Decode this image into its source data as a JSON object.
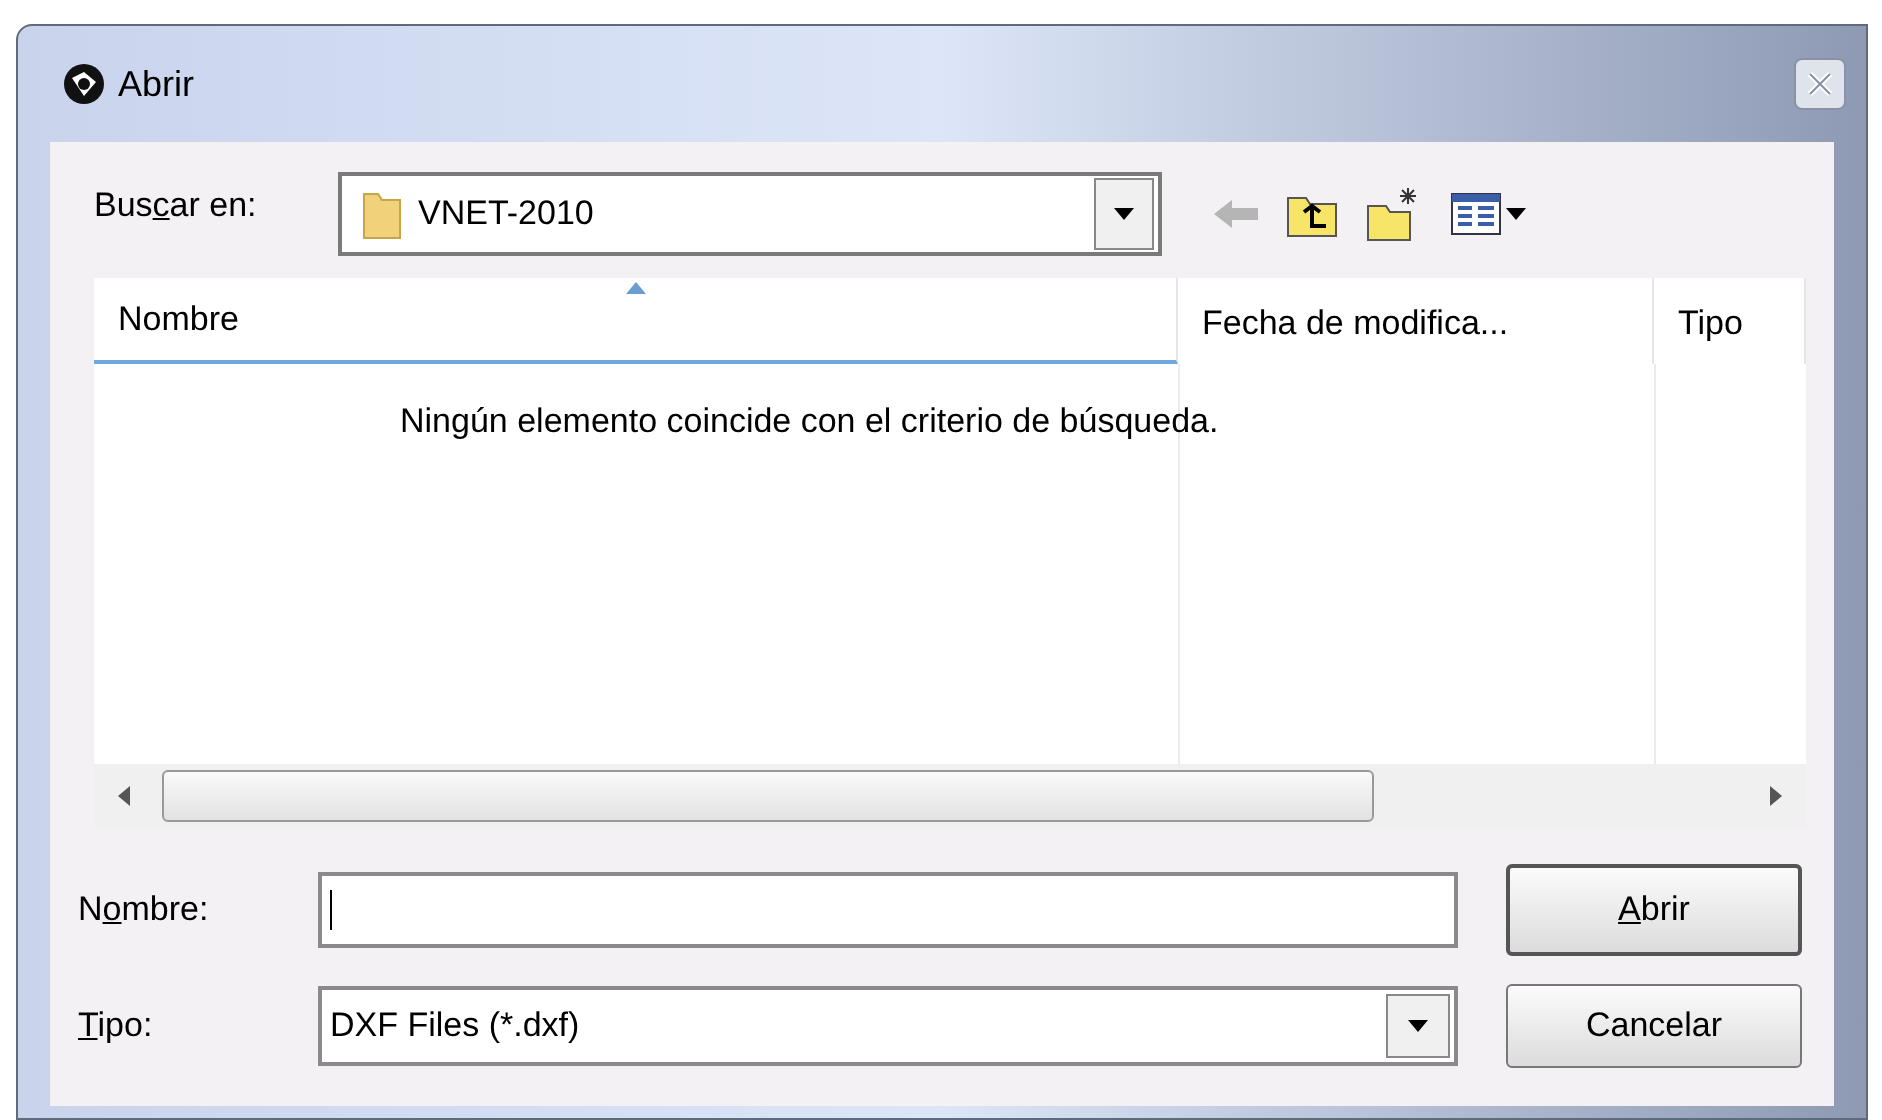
{
  "window": {
    "title": "Abrir"
  },
  "look_in": {
    "label_parts": [
      {
        "text": "Bus",
        "underlined": false
      },
      {
        "text": "c",
        "underlined": true
      },
      {
        "text": "ar en:",
        "underlined": false
      }
    ],
    "value": "VNET-2010"
  },
  "file_list": {
    "columns": [
      {
        "label": "Nombre",
        "sorted": true
      },
      {
        "label": "Fecha de modifica...",
        "sorted": false
      },
      {
        "label": "Tipo",
        "sorted": false
      }
    ],
    "empty_message": "Ningún elemento coincide con el criterio de búsqueda."
  },
  "file_name": {
    "label_parts": [
      {
        "text": "N",
        "underlined": false
      },
      {
        "text": "o",
        "underlined": true
      },
      {
        "text": "mbre:",
        "underlined": false
      }
    ],
    "focused": true
  },
  "file_type": {
    "label_parts": [
      {
        "text": "T",
        "underlined": true
      },
      {
        "text": "ipo:",
        "underlined": false
      }
    ],
    "value": "DXF Files (*.dxf)"
  },
  "buttons": [
    {
      "label_parts": [
        {
          "text": "A",
          "underlined": true
        },
        {
          "text": "brir",
          "underlined": false
        }
      ],
      "default": true
    },
    {
      "label_parts": [
        {
          "text": "Cancelar",
          "underlined": false
        }
      ],
      "default": false
    }
  ]
}
